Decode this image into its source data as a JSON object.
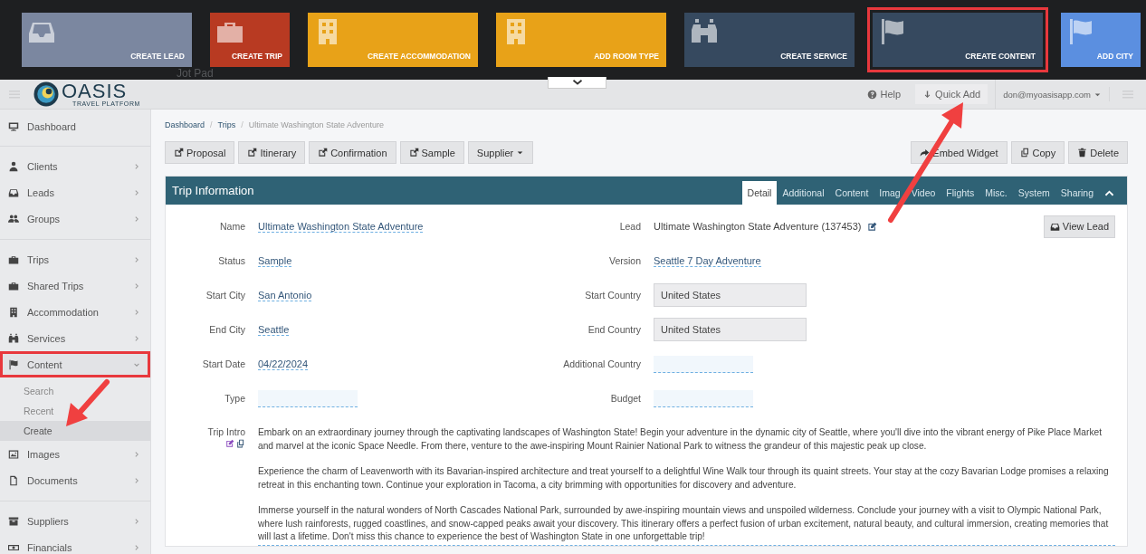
{
  "quick_add_bar": {
    "background_text": "Jot Pad",
    "tiles": [
      {
        "label": "CREATE LEAD",
        "color": "#7b87a0",
        "highlighted": false
      },
      {
        "label": "CREATE TRIP",
        "color": "#b83a22",
        "highlighted": false
      },
      {
        "label": "CREATE ACCOMMODATION",
        "color": "#e8a218",
        "highlighted": false
      },
      {
        "label": "ADD ROOM TYPE",
        "color": "#e8a218",
        "highlighted": false
      },
      {
        "label": "CREATE SERVICE",
        "color": "#36495f",
        "highlighted": false
      },
      {
        "label": "CREATE CONTENT",
        "color": "#36495f",
        "highlighted": true
      },
      {
        "label": "ADD CITY",
        "color": "#5b8fe0",
        "highlighted": false
      }
    ]
  },
  "header": {
    "logo": {
      "name": "OASIS",
      "tagline": "TRAVEL PLATFORM"
    },
    "help": "Help",
    "quick_add": "Quick Add",
    "user": "don@myoasisapp.com"
  },
  "sidebar": {
    "groups": [
      [
        {
          "label": "Dashboard",
          "kind": "link",
          "highlighted": false
        }
      ],
      [
        {
          "label": "Clients",
          "kind": "menu",
          "expanded": false,
          "highlighted": false
        },
        {
          "label": "Leads",
          "kind": "menu",
          "expanded": false,
          "highlighted": false
        },
        {
          "label": "Groups",
          "kind": "menu",
          "expanded": false,
          "highlighted": false
        }
      ],
      [
        {
          "label": "Trips",
          "kind": "menu",
          "expanded": false,
          "highlighted": false
        },
        {
          "label": "Shared Trips",
          "kind": "menu",
          "expanded": false,
          "highlighted": false
        },
        {
          "label": "Accommodation",
          "kind": "menu",
          "expanded": false,
          "highlighted": false
        },
        {
          "label": "Services",
          "kind": "menu",
          "expanded": false,
          "highlighted": false
        },
        {
          "label": "Content",
          "kind": "menu",
          "expanded": true,
          "highlighted": true,
          "children": [
            {
              "label": "Search",
              "selected": false
            },
            {
              "label": "Recent",
              "selected": false
            },
            {
              "label": "Create",
              "selected": true
            }
          ]
        },
        {
          "label": "Images",
          "kind": "menu",
          "expanded": false,
          "highlighted": false
        },
        {
          "label": "Documents",
          "kind": "menu",
          "expanded": false,
          "highlighted": false
        }
      ],
      [
        {
          "label": "Suppliers",
          "kind": "menu",
          "expanded": false,
          "highlighted": false
        },
        {
          "label": "Financials",
          "kind": "menu",
          "expanded": false,
          "highlighted": false
        }
      ]
    ]
  },
  "breadcrumb": {
    "items": [
      {
        "label": "Dashboard",
        "current": false
      },
      {
        "label": "Trips",
        "current": false
      },
      {
        "label": "Ultimate Washington State Adventure",
        "current": true
      }
    ],
    "separators": [
      "/",
      "/"
    ]
  },
  "toolbar": {
    "left": [
      {
        "label": "Proposal",
        "kind": "link"
      },
      {
        "label": "Itinerary",
        "kind": "link"
      },
      {
        "label": "Confirmation",
        "kind": "link"
      },
      {
        "label": "Sample",
        "kind": "link"
      },
      {
        "label": "Supplier",
        "kind": "dropdown"
      }
    ],
    "right": [
      {
        "label": "Embed Widget"
      },
      {
        "label": "Copy"
      },
      {
        "label": "Delete"
      }
    ]
  },
  "panel": {
    "title": "Trip Information",
    "tabs": [
      {
        "label": "Detail",
        "selected": true
      },
      {
        "label": "Additional",
        "selected": false
      },
      {
        "label": "Content",
        "selected": false
      },
      {
        "label": "Imag",
        "selected": false
      },
      {
        "label": "Video",
        "selected": false
      },
      {
        "label": "Flights",
        "selected": false
      },
      {
        "label": "Misc.",
        "selected": false
      },
      {
        "label": "System",
        "selected": false
      },
      {
        "label": "Sharing",
        "selected": false
      }
    ],
    "view_lead_button": "View Lead",
    "rows": [
      {
        "left": {
          "label": "Name",
          "value": "Ultimate Washington State Adventure",
          "kind": "editable"
        },
        "right": {
          "label": "Lead",
          "value": "Ultimate Washington State Adventure (137453)",
          "kind": "linked"
        }
      },
      {
        "left": {
          "label": "Status",
          "value": "Sample",
          "kind": "editable"
        },
        "right": {
          "label": "Version",
          "value": "Seattle 7 Day Adventure",
          "kind": "editable"
        }
      },
      {
        "left": {
          "label": "Start City",
          "value": "San Antonio",
          "kind": "editable"
        },
        "right": {
          "label": "Start Country",
          "value": "United States",
          "kind": "readonly"
        }
      },
      {
        "left": {
          "label": "End City",
          "value": "Seattle",
          "kind": "editable"
        },
        "right": {
          "label": "End Country",
          "value": "United States",
          "kind": "readonly"
        }
      },
      {
        "left": {
          "label": "Start Date",
          "value": "04/22/2024",
          "kind": "editable"
        },
        "right": {
          "label": "Additional Country",
          "kind": "empty"
        }
      },
      {
        "left": {
          "label": "Type",
          "kind": "empty"
        },
        "right": {
          "label": "Budget",
          "kind": "empty"
        }
      }
    ],
    "intro": {
      "label": "Trip Intro",
      "paragraphs": [
        "Embark on an extraordinary journey through the captivating landscapes of Washington State! Begin your adventure in the dynamic city of Seattle, where you'll dive into the vibrant energy of Pike Place Market and marvel at the iconic Space Needle. From there, venture to the awe-inspiring Mount Rainier National Park to witness the grandeur of this majestic peak up close.",
        "Experience the charm of Leavenworth with its Bavarian-inspired architecture and treat yourself to a delightful Wine Walk tour through its quaint streets. Your stay at the cozy Bavarian Lodge promises a relaxing retreat in this enchanting town. Continue your exploration in Tacoma, a city brimming with opportunities for discovery and adventure.",
        "Immerse yourself in the natural wonders of North Cascades National Park, surrounded by awe-inspiring mountain views and unspoiled wilderness. Conclude your journey with a visit to Olympic National Park, where lush rainforests, rugged coastlines, and snow-capped peaks await your discovery. This itinerary offers a perfect fusion of urban excitement, natural beauty, and cultural immersion, creating memories that will last a lifetime. Don't miss this chance to experience the best of Washington State in one unforgettable trip!"
      ]
    }
  }
}
